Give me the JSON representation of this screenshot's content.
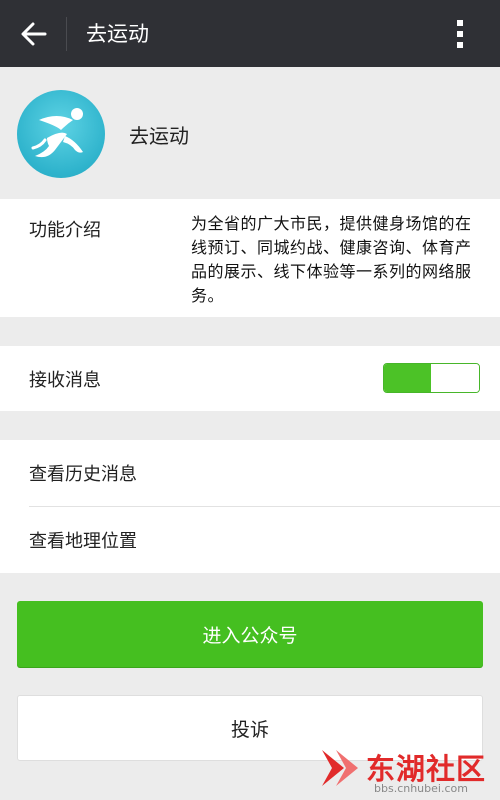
{
  "topbar": {
    "title": "去运动",
    "back_icon": "arrow-left-icon",
    "more_icon": "more-vertical-icon"
  },
  "profile": {
    "name": "去运动",
    "avatar_icon": "running-person-logo"
  },
  "intro": {
    "label": "功能介绍",
    "text": "为全省的广大市民，提供健身场馆的在线预订、同城约战、健康咨询、体育产品的展示、线下体验等一系列的网络服务。"
  },
  "notify": {
    "label": "接收消息",
    "toggle_on": true
  },
  "links": {
    "history": "查看历史消息",
    "location": "查看地理位置"
  },
  "buttons": {
    "enter": "进入公众号",
    "report": "投诉"
  },
  "watermark": {
    "name": "东湖社区",
    "url": "bbs.cnhubei.com"
  },
  "colors": {
    "topbar": "#2f3035",
    "accent_green": "#45bf20",
    "background": "#ececec",
    "watermark_red": "#e12a2a"
  }
}
